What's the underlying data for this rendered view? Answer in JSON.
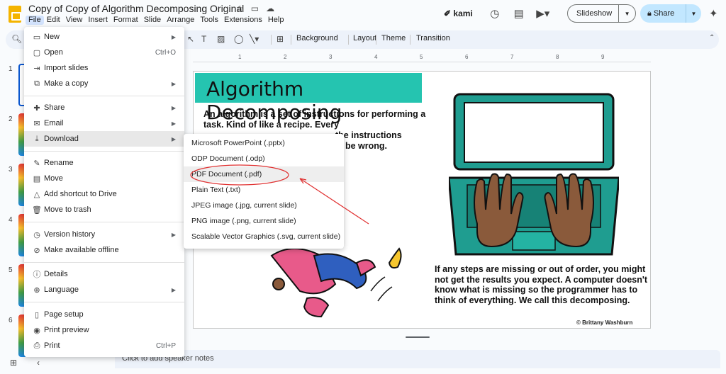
{
  "doc": {
    "title": "Copy of Copy of Algorithm Decomposing Original",
    "menu": [
      "File",
      "Edit",
      "View",
      "Insert",
      "Format",
      "Slide",
      "Arrange",
      "Tools",
      "Extensions",
      "Help"
    ]
  },
  "header": {
    "kami": "kami",
    "slideshow": "Slideshow",
    "share": "Share"
  },
  "toolbar": {
    "background": "Background",
    "layout": "Layout",
    "theme": "Theme",
    "transition": "Transition"
  },
  "ruler": [
    "1",
    "2",
    "3",
    "4",
    "5",
    "6",
    "7",
    "8",
    "9"
  ],
  "filmstrip": {
    "numbers": [
      "1",
      "2",
      "3",
      "4",
      "5",
      "6"
    ]
  },
  "file_menu": {
    "items": [
      {
        "label": "New",
        "shortcut": "",
        "submenu": true,
        "icon": "new-doc-icon"
      },
      {
        "label": "Open",
        "shortcut": "Ctrl+O",
        "submenu": false,
        "icon": "folder-icon"
      },
      {
        "label": "Import slides",
        "shortcut": "",
        "submenu": false,
        "icon": "import-icon"
      },
      {
        "label": "Make a copy",
        "shortcut": "",
        "submenu": true,
        "icon": "copy-icon"
      },
      {
        "label": "Share",
        "shortcut": "",
        "submenu": true,
        "icon": "person-add-icon"
      },
      {
        "label": "Email",
        "shortcut": "",
        "submenu": true,
        "icon": "mail-icon"
      },
      {
        "label": "Download",
        "shortcut": "",
        "submenu": true,
        "icon": "download-icon"
      },
      {
        "label": "Rename",
        "shortcut": "",
        "submenu": false,
        "icon": "rename-icon"
      },
      {
        "label": "Move",
        "shortcut": "",
        "submenu": false,
        "icon": "move-icon"
      },
      {
        "label": "Add shortcut to Drive",
        "shortcut": "",
        "submenu": false,
        "icon": "drive-shortcut-icon"
      },
      {
        "label": "Move to trash",
        "shortcut": "",
        "submenu": false,
        "icon": "trash-icon"
      },
      {
        "label": "Version history",
        "shortcut": "",
        "submenu": true,
        "icon": "history-icon"
      },
      {
        "label": "Make available offline",
        "shortcut": "",
        "submenu": false,
        "icon": "offline-icon"
      },
      {
        "label": "Details",
        "shortcut": "",
        "submenu": false,
        "icon": "info-icon"
      },
      {
        "label": "Language",
        "shortcut": "",
        "submenu": true,
        "icon": "globe-icon"
      },
      {
        "label": "Page setup",
        "shortcut": "",
        "submenu": false,
        "icon": "page-icon"
      },
      {
        "label": "Print preview",
        "shortcut": "",
        "submenu": false,
        "icon": "preview-icon"
      },
      {
        "label": "Print",
        "shortcut": "Ctrl+P",
        "submenu": false,
        "icon": "printer-icon"
      }
    ]
  },
  "download_menu": {
    "items": [
      "Microsoft PowerPoint (.pptx)",
      "ODP Document (.odp)",
      "PDF Document (.pdf)",
      "Plain Text (.txt)",
      "JPEG image (.jpg, current slide)",
      "PNG image (.png, current slide)",
      "Scalable Vector Graphics (.svg, current slide)"
    ]
  },
  "slide": {
    "title": "Algorithm Decomposing",
    "intro": "An algorithm is a set of instructions for performing a task. Kind of like a recipe. Every",
    "intro_line3_right": "the instructions",
    "intro_line4_right": "be wrong.",
    "bottom": "If any steps are missing or out of order, you might not get the results you expect. A computer doesn't know what is missing so the programmer has to think of everything. We call this decomposing.",
    "credit": "© Brittany Washburn"
  },
  "notes": {
    "placeholder": "Click to add speaker notes"
  },
  "colors": {
    "teal": "#25c4b0",
    "menu_highlight": "#d3e3fd",
    "share_bg": "#c2e7ff",
    "annotation_red": "#e03030"
  }
}
